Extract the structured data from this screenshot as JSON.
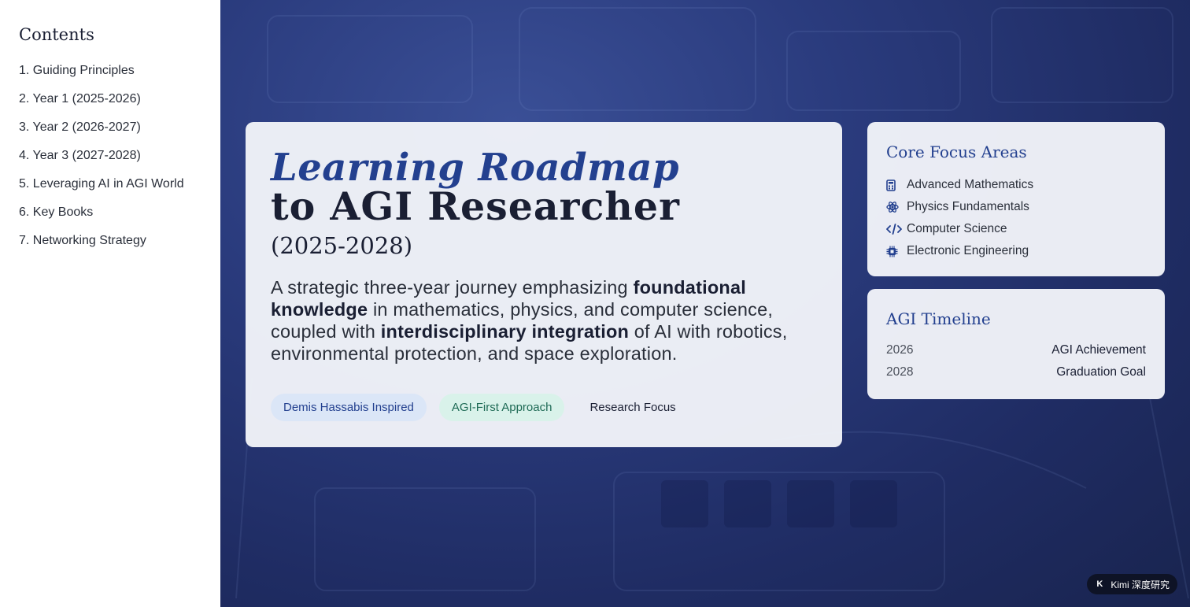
{
  "sidebar": {
    "title": "Contents",
    "items": [
      {
        "label": "1. Guiding Principles"
      },
      {
        "label": "2. Year 1 (2025-2026)"
      },
      {
        "label": "3. Year 2 (2026-2027)"
      },
      {
        "label": "4. Year 3 (2027-2028)"
      },
      {
        "label": "5. Leveraging AI in AGI World"
      },
      {
        "label": "6. Key Books"
      },
      {
        "label": "7. Networking Strategy"
      }
    ]
  },
  "main": {
    "title_line1": "Learning Roadmap",
    "title_line2": "to AGI Researcher",
    "title_line3": "(2025-2028)",
    "desc": {
      "p1": "A strategic three-year journey emphasizing ",
      "b1": "foundational knowledge",
      "p2": " in mathematics, physics, and computer science, coupled with ",
      "b2": "interdisciplinary integration",
      "p3": " of AI with robotics, environmental protection, and space exploration."
    },
    "tags": [
      "Demis Hassabis Inspired",
      "AGI-First Approach",
      "Research Focus"
    ]
  },
  "focus": {
    "title": "Core Focus Areas",
    "items": [
      {
        "label": "Advanced Mathematics",
        "icon": "calculator-icon"
      },
      {
        "label": "Physics Fundamentals",
        "icon": "atom-icon"
      },
      {
        "label": "Computer Science",
        "icon": "code-icon"
      },
      {
        "label": "Electronic Engineering",
        "icon": "microchip-icon"
      }
    ]
  },
  "timeline": {
    "title": "AGI Timeline",
    "rows": [
      {
        "year": "2026",
        "event": "AGI Achievement"
      },
      {
        "year": "2028",
        "event": "Graduation Goal"
      }
    ]
  },
  "badge": {
    "logo": "K",
    "label": "Kimi 深度研究"
  },
  "colors": {
    "accent": "#23408f",
    "hero_bg": "#2a3b7d",
    "tag_blue": "#dbe6f7",
    "tag_green": "#d9f2ea"
  }
}
